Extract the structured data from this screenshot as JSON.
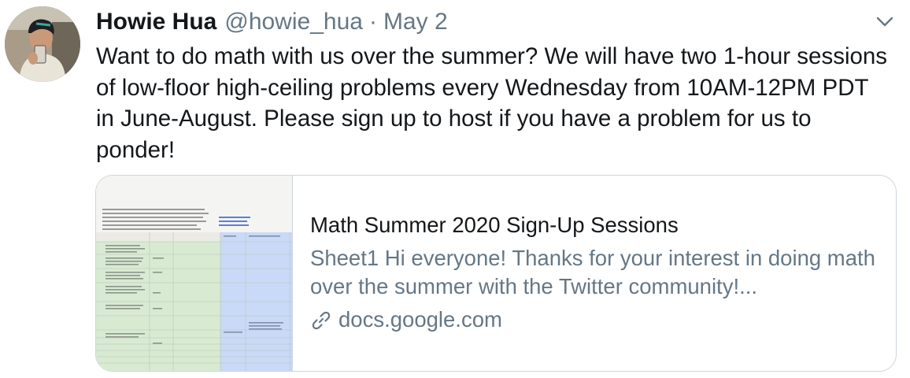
{
  "author": {
    "name": "Howie Hua",
    "handle": "@howie_hua",
    "separator": "·",
    "date": "May 2"
  },
  "tweet": {
    "text": "Want to do math with us over the summer? We will have two 1-hour sessions of low-floor high-ceiling problems every Wednesday from 10AM-12PM PDT in June-August. Please sign up to host if you have a problem for us to ponder!"
  },
  "card": {
    "title": "Math Summer 2020 Sign-Up Sessions",
    "description": "Sheet1 Hi everyone! Thanks for your interest in doing math over the summer with the Twitter community!...",
    "domain": "docs.google.com"
  },
  "icons": {
    "menu": "chevron-down-icon",
    "link": "link-icon"
  },
  "colors": {
    "text": "#14171a",
    "secondary": "#657786",
    "border": "#ccd6dd",
    "sheet_green": "#d9ead3",
    "sheet_blue": "#c9daf8"
  }
}
